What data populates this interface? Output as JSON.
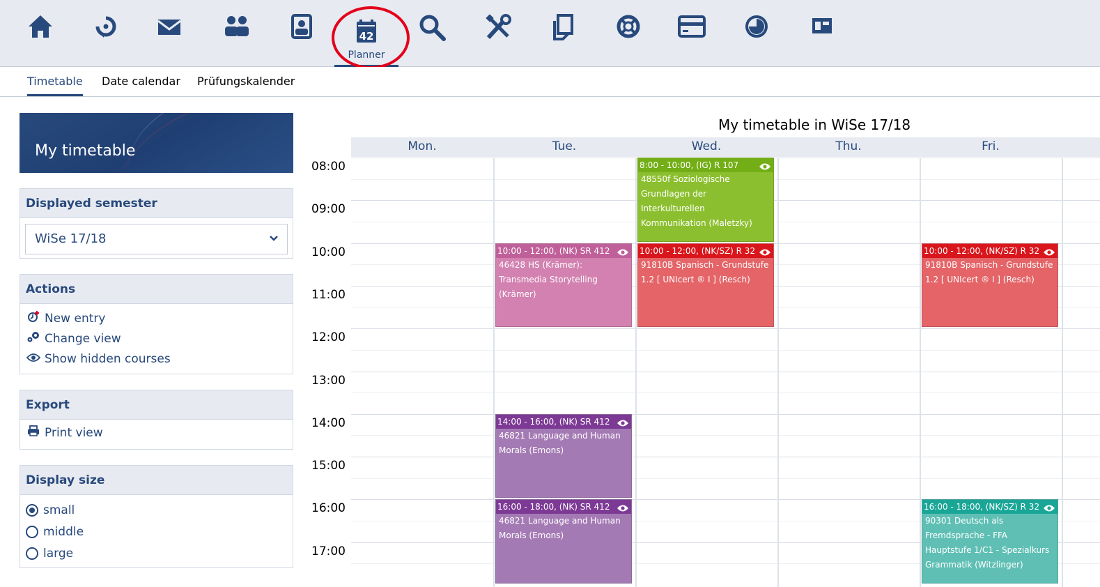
{
  "nav": {
    "planner_label": "Planner",
    "planner_badge": "42",
    "icons": [
      "home-icon",
      "undo-icon",
      "mail-icon",
      "people-icon",
      "contact-icon",
      "planner-icon",
      "search-icon",
      "tools-icon",
      "documents-icon",
      "lifebuoy-icon",
      "card-icon",
      "pie-icon",
      "layout-icon"
    ]
  },
  "subnav": {
    "tabs": [
      "Timetable",
      "Date calendar",
      "Prüfungskalender"
    ]
  },
  "sidebar": {
    "title": "My timetable",
    "semester": {
      "heading": "Displayed semester",
      "value": "WiSe 17/18"
    },
    "actions": {
      "heading": "Actions",
      "new_entry": "New entry",
      "change_view": "Change view",
      "show_hidden": "Show hidden courses"
    },
    "export": {
      "heading": "Export",
      "print_view": "Print view"
    },
    "display_size": {
      "heading": "Display size",
      "small": "small",
      "middle": "middle",
      "large": "large",
      "selected": "small"
    }
  },
  "timetable": {
    "title": "My timetable in WiSe 17/18",
    "days": [
      "Mon.",
      "Tue.",
      "Wed.",
      "Thu.",
      "Fri."
    ],
    "hours": [
      "08:00",
      "09:00",
      "10:00",
      "11:00",
      "12:00",
      "13:00",
      "14:00",
      "15:00",
      "16:00",
      "17:00"
    ],
    "events": [
      {
        "day": "Wed.",
        "start": "8:00",
        "end": "10:00",
        "head": "8:00 - 10:00, (IG) R 107",
        "body": "48550f Soziologische Grundlagen der Interkulturellen Kommunikation (Maletzky)",
        "color": "#8cbf2f",
        "headcolor": "#73ae17"
      },
      {
        "day": "Tue.",
        "start": "10:00",
        "end": "12:00",
        "head": "10:00 - 12:00, (NK) SR 412",
        "body": "46428 HS (Krämer): Transmedia Storytelling (Krämer)",
        "color": "#d281b0",
        "headcolor": "#c0609a"
      },
      {
        "day": "Wed.",
        "start": "10:00",
        "end": "12:00",
        "head": "10:00 - 12:00, (NK/SZ) R 32",
        "body": "91810B Spanisch - Grundstufe 1.2 [ UNIcert ® I ] (Resch)",
        "color": "#e46468",
        "headcolor": "#d9161c"
      },
      {
        "day": "Fri.",
        "start": "10:00",
        "end": "12:00",
        "head": "10:00 - 12:00, (NK/SZ) R 32",
        "body": "91810B Spanisch - Grundstufe 1.2 [ UNIcert ® I ] (Resch)",
        "color": "#e46468",
        "headcolor": "#d9161c"
      },
      {
        "day": "Tue.",
        "start": "14:00",
        "end": "16:00",
        "head": "14:00 - 16:00, (NK) SR 412",
        "body": "46821 Language and Human Morals (Emons)",
        "color": "#a47ab4",
        "headcolor": "#7d3a95"
      },
      {
        "day": "Tue.",
        "start": "16:00",
        "end": "18:00",
        "head": "16:00 - 18:00, (NK) SR 412",
        "body": "46821 Language and Human Morals (Emons)",
        "color": "#a47ab4",
        "headcolor": "#7d3a95"
      },
      {
        "day": "Fri.",
        "start": "16:00",
        "end": "18:00",
        "head": "16:00 - 18:00, (NK/SZ) R 32",
        "body": "90301 Deutsch als Fremdsprache - FFA Hauptstufe 1/C1 - Spezialkurs Grammatik (Witzlinger)",
        "color": "#5fbfb4",
        "headcolor": "#1aa697"
      }
    ]
  },
  "colors": {
    "brand": "#28497c",
    "highlight": "#e3001b"
  }
}
